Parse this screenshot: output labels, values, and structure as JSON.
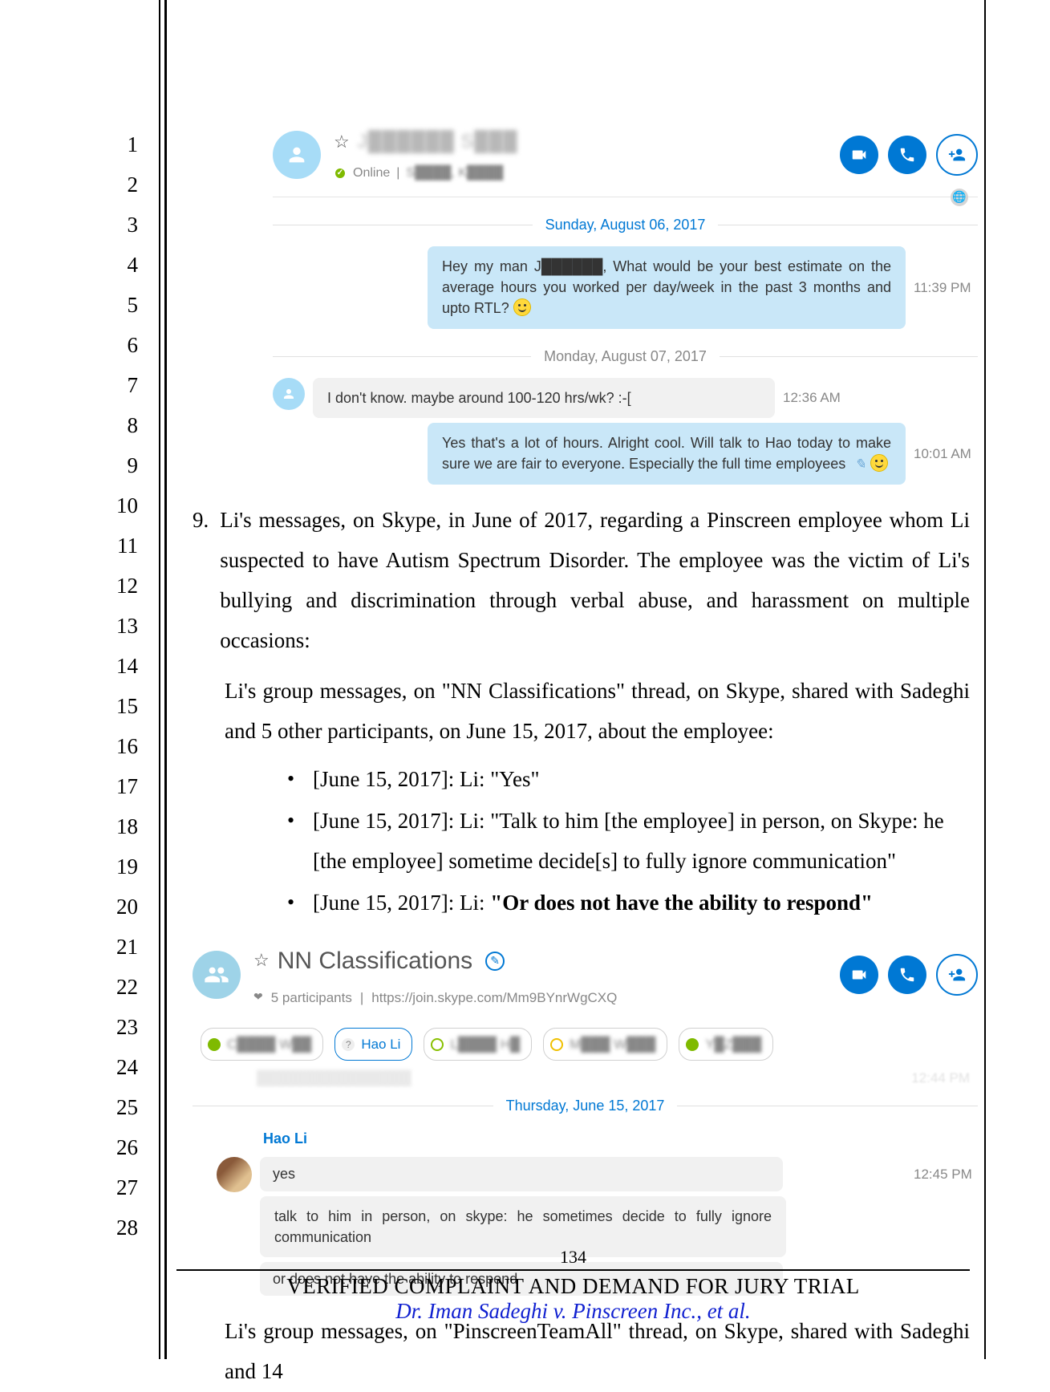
{
  "lineNumbers": [
    1,
    2,
    3,
    4,
    5,
    6,
    7,
    8,
    9,
    10,
    11,
    12,
    13,
    14,
    15,
    16,
    17,
    18,
    19,
    20,
    21,
    22,
    23,
    24,
    25,
    26,
    27,
    28
  ],
  "skype1": {
    "contactName": "J██████ S███",
    "statusText": "Online",
    "locationText": "S████, K████",
    "date1": "Sunday, August 06, 2017",
    "msg1": "Hey my man J██████, What would be your best estimate on the average hours you worked per day/week in the past 3 months and upto RTL?",
    "ts1": "11:39 PM",
    "date2": "Monday, August 07, 2017",
    "msg2": "I don't know. maybe around 100-120 hrs/wk? :-[",
    "ts2": "12:36 AM",
    "msg3": "Yes that's a lot of hours. Alright cool. Will talk to Hao today to make sure we are fair to everyone. Especially the full time employees",
    "ts3": "10:01 AM"
  },
  "legal": {
    "itemNum": "9.",
    "para1": "Li's messages, on Skype, in June of 2017, regarding a Pinscreen employee whom Li suspected to have Autism Spectrum Disorder. The employee was the victim of Li's bullying and discrimination through verbal abuse, and harassment on multiple occasions:",
    "para2": "Li's group messages, on \"NN Classifications\" thread, on Skype, shared with Sadeghi and 5 other participants, on June 15, 2017, about the employee:",
    "b1": "[June 15, 2017]: Li: \"Yes\"",
    "b2": "[June 15, 2017]: Li: \"Talk to him [the employee] in person, on Skype: he [the employee] sometime decide[s] to fully ignore communication\"",
    "b3prefix": "[June 15, 2017]: Li: ",
    "b3bold": "\"Or does not have the ability to respond\"",
    "para3": "Li's group messages, on \"PinscreenTeamAll\" thread, on Skype, shared with Sadeghi and 14"
  },
  "skype2": {
    "groupName": "NN Classifications",
    "participantsText": "5 participants",
    "link": "https://join.skype.com/Mm9BYnrWgCXQ",
    "chip1": "C████ W██",
    "chip2": "Hao Li",
    "chip3": "L████ H█",
    "chip4": "M███ W███",
    "chip5": "Y█Z███",
    "dateRedacted": "████████████████",
    "date": "Thursday, June 15, 2017",
    "tsRedacted": "12:44 PM",
    "sender": "Hao Li",
    "msgA": "yes",
    "msgB": "talk to him in person, on skype: he sometimes decide to fully ignore communication",
    "msgC": "or does not have the ability to respond",
    "ts": "12:45 PM"
  },
  "footer": {
    "pageNum": "134",
    "line1": "VERIFIED COMPLAINT AND DEMAND FOR JURY TRIAL",
    "line2": "Dr. Iman Sadeghi v. Pinscreen Inc., et al."
  }
}
